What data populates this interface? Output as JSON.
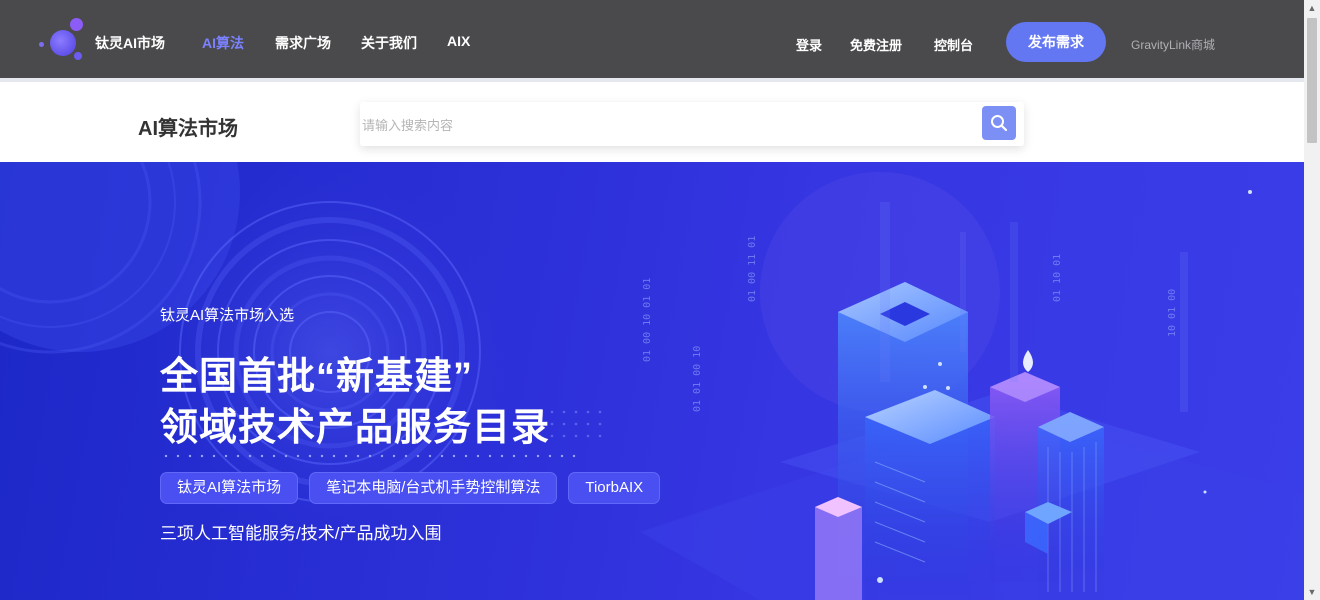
{
  "header": {
    "brand": "钛灵AI市场",
    "nav": [
      "AI算法",
      "需求广场",
      "关于我们",
      "AIX"
    ],
    "login": "登录",
    "register": "免费注册",
    "console": "控制台",
    "publish": "发布需求",
    "gravitylink": "GravityLink商城"
  },
  "search": {
    "page_title": "AI算法市场",
    "placeholder": "请输入搜索内容"
  },
  "banner": {
    "kicker": "钛灵AI算法市场入选",
    "title_line1": "全国首批“新基建”",
    "title_line2": "领域技术产品服务目录",
    "tags": [
      "钛灵AI算法市场",
      "笔记本电脑/台式机手势控制算法",
      "TiorbAIX"
    ],
    "subtitle": "三项人工智能服务/技术/产品成功入围"
  },
  "colors": {
    "navbar": "#4a4a4c",
    "accent": "#6477f2",
    "active_nav": "#7b82ff",
    "banner": "#2a2fd6"
  },
  "icons": [
    "search-icon",
    "scroll-up-icon",
    "scroll-down-icon"
  ]
}
